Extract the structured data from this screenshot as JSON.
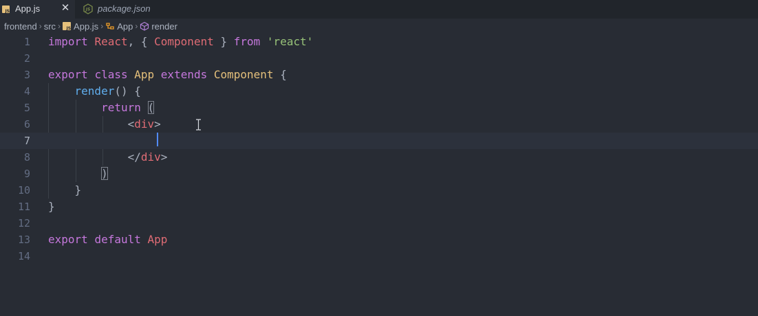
{
  "tabs": [
    {
      "label": "App.js",
      "active": true,
      "icon": "js-file-icon",
      "close": "✕"
    },
    {
      "label": "package.json",
      "active": false,
      "icon": "nodejs-icon"
    }
  ],
  "breadcrumb": {
    "items": [
      "frontend",
      "src",
      "App.js",
      "App",
      "render"
    ],
    "separator": "›"
  },
  "editor": {
    "current_line": 7,
    "lines": [
      {
        "number": "1"
      },
      {
        "number": "2"
      },
      {
        "number": "3"
      },
      {
        "number": "4"
      },
      {
        "number": "5"
      },
      {
        "number": "6"
      },
      {
        "number": "7"
      },
      {
        "number": "8"
      },
      {
        "number": "9"
      },
      {
        "number": "10"
      },
      {
        "number": "11"
      },
      {
        "number": "12"
      },
      {
        "number": "13"
      },
      {
        "number": "14"
      }
    ],
    "tokens": {
      "l1_import": "import",
      "l1_react": "React",
      "l1_comma": ", { ",
      "l1_component": "Component",
      "l1_close": " } ",
      "l1_from": "from",
      "l1_str": "'react'",
      "l3_export": "export",
      "l3_class": "class",
      "l3_app": "App",
      "l3_extends": "extends",
      "l3_component": "Component",
      "l3_brace": " {",
      "l4_render": "render",
      "l4_rest": "() {",
      "l5_return": "return",
      "l5_paren": "(",
      "l6_lt": "<",
      "l6_tag": "div",
      "l6_gt": ">",
      "l8_lt": "</",
      "l8_tag": "div",
      "l8_gt": ">",
      "l9_paren": ")",
      "l10_brace": "}",
      "l11_brace": "}",
      "l13_export": "export",
      "l13_default": "default",
      "l13_app": "App"
    }
  },
  "colors": {
    "background": "#282c34",
    "tabbar": "#21252b",
    "keyword": "#c678dd",
    "class_name": "#e06c75",
    "type": "#e5c07b",
    "string": "#98c379",
    "function": "#61afef",
    "cursor": "#528bff"
  }
}
